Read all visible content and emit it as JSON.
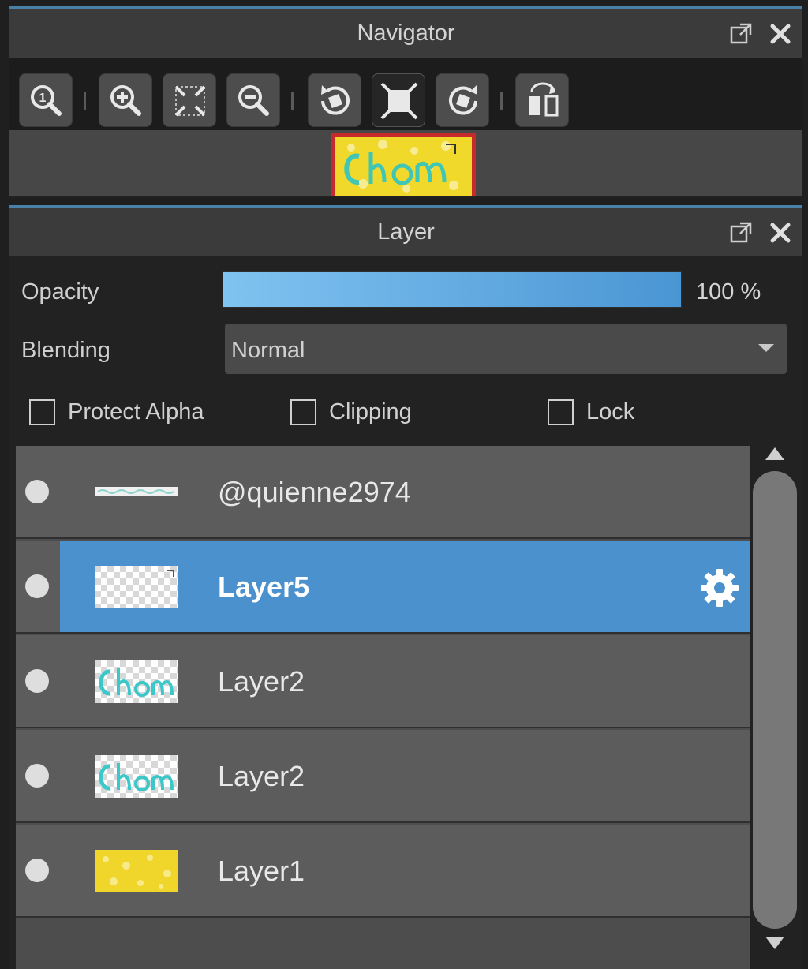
{
  "navigator": {
    "title": "Navigator",
    "header_buttons": [
      "popout-icon",
      "close-icon"
    ],
    "toolbar": [
      {
        "name": "zoom-actual-icon",
        "active": false
      },
      {
        "name": "zoom-in-icon",
        "active": false
      },
      {
        "name": "fit-to-window-icon",
        "active": false
      },
      {
        "name": "zoom-out-icon",
        "active": false
      },
      {
        "name": "rotate-left-icon",
        "active": false
      },
      {
        "name": "fit-canvas-icon",
        "active": true
      },
      {
        "name": "rotate-right-icon",
        "active": false
      },
      {
        "name": "flip-horizontal-icon",
        "active": false
      }
    ]
  },
  "layer_panel": {
    "title": "Layer",
    "opacity": {
      "label": "Opacity",
      "value_text": "100 %",
      "value": 100
    },
    "blending": {
      "label": "Blending",
      "value": "Normal"
    },
    "checkboxes": {
      "protect_alpha": {
        "label": "Protect Alpha",
        "checked": false
      },
      "clipping": {
        "label": "Clipping",
        "checked": false
      },
      "lock": {
        "label": "Lock",
        "checked": false
      }
    },
    "layers": [
      {
        "name": "@quienne2974",
        "thumb": "text-strip",
        "selected": false
      },
      {
        "name": "Layer5",
        "thumb": "transparent",
        "selected": true
      },
      {
        "name": "Layer2",
        "thumb": "cyan-text",
        "selected": false
      },
      {
        "name": "Layer2",
        "thumb": "cyan-text",
        "selected": false
      },
      {
        "name": "Layer1",
        "thumb": "yellow",
        "selected": false
      }
    ]
  },
  "colors": {
    "accent_selected": "#4b91cd",
    "opacity_start": "#7fc3f0",
    "opacity_end": "#4a95d4",
    "preview_border": "#c72a2a",
    "preview_fill": "#f2da2a"
  }
}
